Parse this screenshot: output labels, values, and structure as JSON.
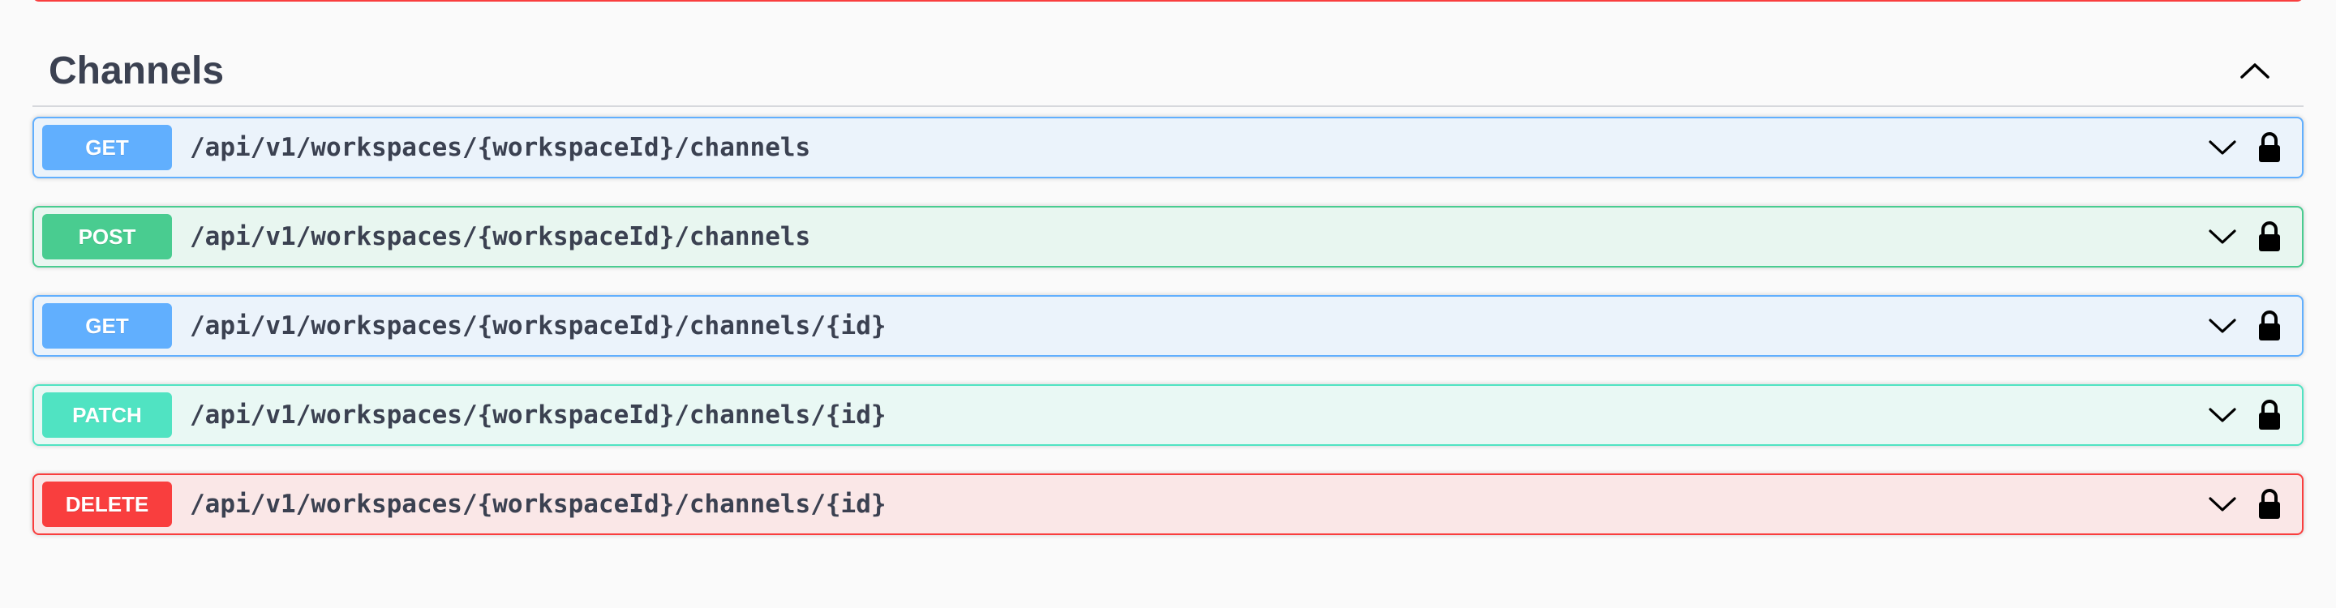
{
  "section": {
    "title": "Channels",
    "collapse_icon": "chevron-up-icon"
  },
  "operations": [
    {
      "method": "GET",
      "path": "/api/v1/workspaces/{workspaceId}/channels",
      "color": "#61affe"
    },
    {
      "method": "POST",
      "path": "/api/v1/workspaces/{workspaceId}/channels",
      "color": "#49cc90"
    },
    {
      "method": "GET",
      "path": "/api/v1/workspaces/{workspaceId}/channels/{id}",
      "color": "#61affe"
    },
    {
      "method": "PATCH",
      "path": "/api/v1/workspaces/{workspaceId}/channels/{id}",
      "color": "#50e3c2"
    },
    {
      "method": "DELETE",
      "path": "/api/v1/workspaces/{workspaceId}/channels/{id}",
      "color": "#f93e3e"
    }
  ],
  "icons": {
    "expand": "chevron-down-icon",
    "auth": "lock-icon"
  }
}
